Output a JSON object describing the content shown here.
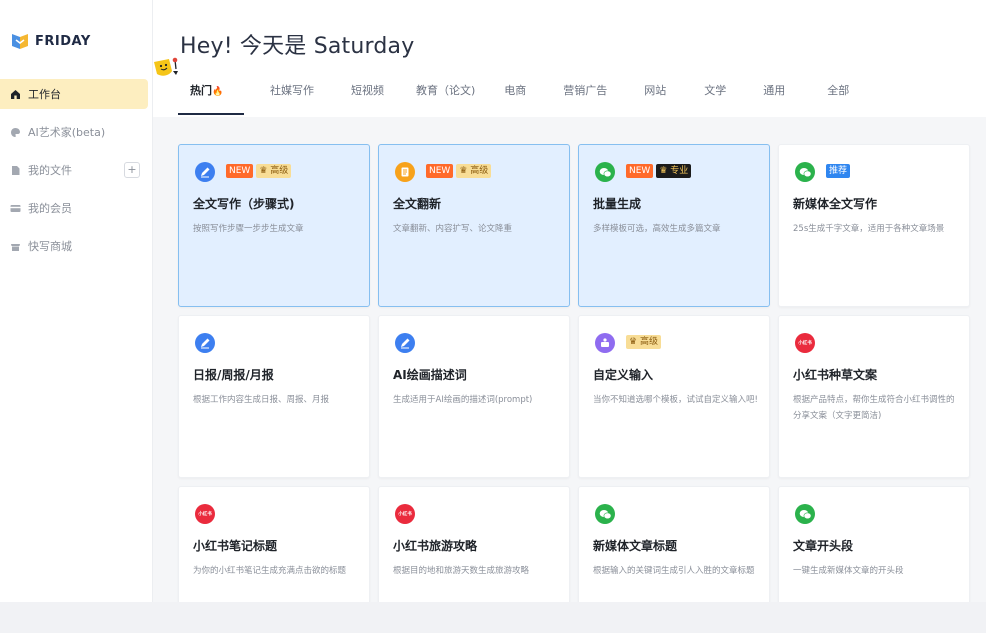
{
  "brand": {
    "name": "FRIDAY"
  },
  "sidebar": {
    "items": [
      {
        "label": "工作台",
        "icon": "home-icon"
      },
      {
        "label": "AI艺术家(beta)",
        "icon": "palette-icon"
      },
      {
        "label": "我的文件",
        "icon": "file-icon",
        "action": "+"
      },
      {
        "label": "我的会员",
        "icon": "card-icon"
      },
      {
        "label": "快写商城",
        "icon": "shop-icon"
      }
    ]
  },
  "header": {
    "greeting": "Hey! 今天是 Saturday",
    "mascot": "mascot-icon"
  },
  "tabs": [
    {
      "label": "热门"
    },
    {
      "label": "社媒写作"
    },
    {
      "label": "短视频"
    },
    {
      "label": "教育（论文)"
    },
    {
      "label": "电商"
    },
    {
      "label": "营销广告"
    },
    {
      "label": "网站"
    },
    {
      "label": "文学"
    },
    {
      "label": "通用"
    },
    {
      "label": "全部"
    }
  ],
  "hot_flame": "🔥",
  "colors": {
    "accent_active": "#fdeec0",
    "featured_bg": "#e2efff",
    "featured_border": "#86bff0",
    "badge_new": "#ff6a2a",
    "badge_gold": "#f8dd96",
    "wechat_green": "#2bb24c",
    "xiaohongshu_red": "#ea2b3d"
  },
  "cards": [
    {
      "title": "全文写作（步骤式)",
      "desc": "按照写作步骤一步步生成文章",
      "icon": "pen-icon",
      "badges": [
        "NEW",
        "高级"
      ],
      "featured": true
    },
    {
      "title": "全文翻新",
      "desc": "文章翻新、内容扩写、论文降重",
      "icon": "document-icon",
      "badges": [
        "NEW",
        "高级"
      ],
      "featured": true
    },
    {
      "title": "批量生成",
      "desc": "多样模板可选，高效生成多篇文章",
      "icon": "wechat-icon",
      "badges": [
        "NEW",
        "专业"
      ],
      "featured": true
    },
    {
      "title": "新媒体全文写作",
      "desc": "25s生成千字文章，适用于各种文章场景",
      "icon": "wechat-icon",
      "badges": [
        "推荐"
      ],
      "featured": false
    },
    {
      "title": "日报/周报/月报",
      "desc": "根据工作内容生成日报、周报、月报",
      "icon": "pen-icon",
      "badges": [],
      "featured": false
    },
    {
      "title": "AI绘画描述词",
      "desc": "生成适用于AI绘画的描述词(prompt)",
      "icon": "pen-icon",
      "badges": [],
      "featured": false
    },
    {
      "title": "自定义输入",
      "desc": "当你不知道选哪个模板，试试自定义输入吧!",
      "icon": "custom-icon",
      "badges": [
        "高级"
      ],
      "featured": false
    },
    {
      "title": "小红书种草文案",
      "desc": "根据产品特点，帮你生成符合小红书调性的分享文案（文字更简洁)",
      "icon": "xiaohongshu-icon",
      "badges": [],
      "featured": false
    },
    {
      "title": "小红书笔记标题",
      "desc": "为你的小红书笔记生成充满点击欲的标题",
      "icon": "xiaohongshu-icon",
      "badges": [],
      "featured": false
    },
    {
      "title": "小红书旅游攻略",
      "desc": "根据目的地和旅游天数生成旅游攻略",
      "icon": "xiaohongshu-icon",
      "badges": [],
      "featured": false
    },
    {
      "title": "新媒体文章标题",
      "desc": "根据输入的关键词生成引人入胜的文章标题",
      "icon": "wechat-icon",
      "badges": [],
      "featured": false
    },
    {
      "title": "文章开头段",
      "desc": "一键生成新媒体文章的开头段",
      "icon": "wechat-icon",
      "badges": [],
      "featured": false
    }
  ],
  "icon_text": {
    "xiaohongshu": "小红书"
  }
}
